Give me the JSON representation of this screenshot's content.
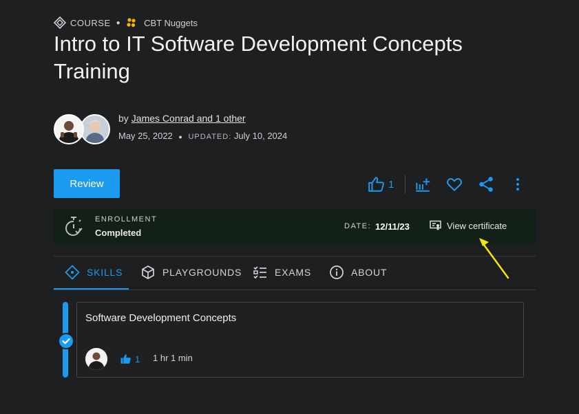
{
  "header": {
    "type_label": "COURSE",
    "provider": "CBT Nuggets",
    "title": "Intro to IT Software Development Concepts Training"
  },
  "authors": {
    "by_label": "by",
    "names": "James Conrad and 1 other",
    "published": "May 25, 2022",
    "updated_label": "UPDATED:",
    "updated": "July 10, 2024"
  },
  "actions": {
    "review_label": "Review",
    "like_count": "1"
  },
  "enrollment": {
    "label": "ENROLLMENT",
    "status": "Completed",
    "date_label": "DATE:",
    "date": "12/11/23",
    "certificate_label": "View certificate"
  },
  "tabs": [
    {
      "label": "SKILLS"
    },
    {
      "label": "PLAYGROUNDS"
    },
    {
      "label": "EXAMS"
    },
    {
      "label": "ABOUT"
    }
  ],
  "skill": {
    "title": "Software Development Concepts",
    "likes": "1",
    "duration": "1 hr 1 min"
  },
  "colors": {
    "accent": "#1a9bf0",
    "background": "#1e1f21",
    "enrollment_bg": "#132017",
    "annotation_arrow": "#f5e60c"
  }
}
